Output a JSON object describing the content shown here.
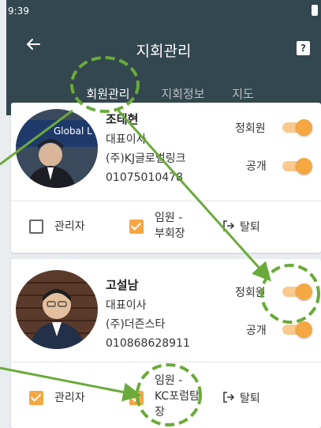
{
  "status_bar": {
    "time": "9:39"
  },
  "app_bar": {
    "title": "지회관리",
    "help_label": "?"
  },
  "tabs": [
    {
      "label": "회원관리",
      "active": true
    },
    {
      "label": "지회정보",
      "active": false
    },
    {
      "label": "지도",
      "active": false
    }
  ],
  "members": [
    {
      "name": "조태현",
      "title": "대표이사",
      "company": "(주)KJ글로벌링크",
      "phone": "01075010478",
      "status_label": "정회원",
      "status_on": true,
      "public_label": "공개",
      "public_on": true,
      "avatar_banner_text": "Global L",
      "admin_label": "관리자",
      "admin_checked": false,
      "role_label_line1": "임원 -",
      "role_label_line2": "부회장",
      "role_checked": true,
      "leave_label": "탈퇴"
    },
    {
      "name": "고설남",
      "title": "대표이사",
      "company": "(주)더즌스타",
      "phone": "010868628911",
      "status_label": "정회원",
      "status_on": true,
      "public_label": "공개",
      "public_on": true,
      "admin_label": "관리자",
      "admin_checked": true,
      "role_label_line1": "임원 -",
      "role_label_line2": "KC포럼탐",
      "role_label_line3": "장",
      "role_checked": true,
      "leave_label": "탈퇴"
    }
  ],
  "colors": {
    "app_bar": "#33474f",
    "accent": "#f5a742",
    "annotation": "#6aaa3a",
    "background": "#e9edf0"
  },
  "icons": {
    "back": "arrow-left-icon",
    "help": "help-icon",
    "leave": "logout-icon"
  }
}
